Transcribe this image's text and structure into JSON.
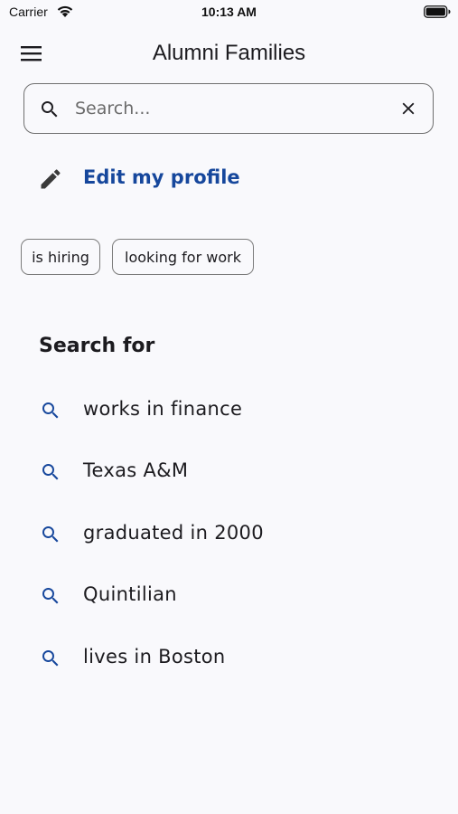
{
  "status_bar": {
    "carrier": "Carrier",
    "time": "10:13 AM"
  },
  "app_bar": {
    "title": "Alumni Families",
    "menu_icon": "hamburger-menu-icon"
  },
  "search": {
    "placeholder": "Search...",
    "value": "",
    "icon": "search-icon",
    "clear_icon": "close-icon"
  },
  "edit_profile": {
    "label": "Edit my profile",
    "icon": "pencil-icon"
  },
  "chips": [
    {
      "label": "is hiring"
    },
    {
      "label": "looking for work"
    }
  ],
  "search_for": {
    "heading": "Search for",
    "items": [
      {
        "label": "works in finance",
        "icon": "search-icon"
      },
      {
        "label": "Texas A&M",
        "icon": "search-icon"
      },
      {
        "label": "graduated in 2000",
        "icon": "search-icon"
      },
      {
        "label": "Quintilian",
        "icon": "search-icon"
      },
      {
        "label": "lives in Boston",
        "icon": "search-icon"
      }
    ]
  },
  "colors": {
    "background": "#F9F9FC",
    "accent": "#16479C",
    "text": "#1C1B1F",
    "outline": "#7B7B7B"
  }
}
